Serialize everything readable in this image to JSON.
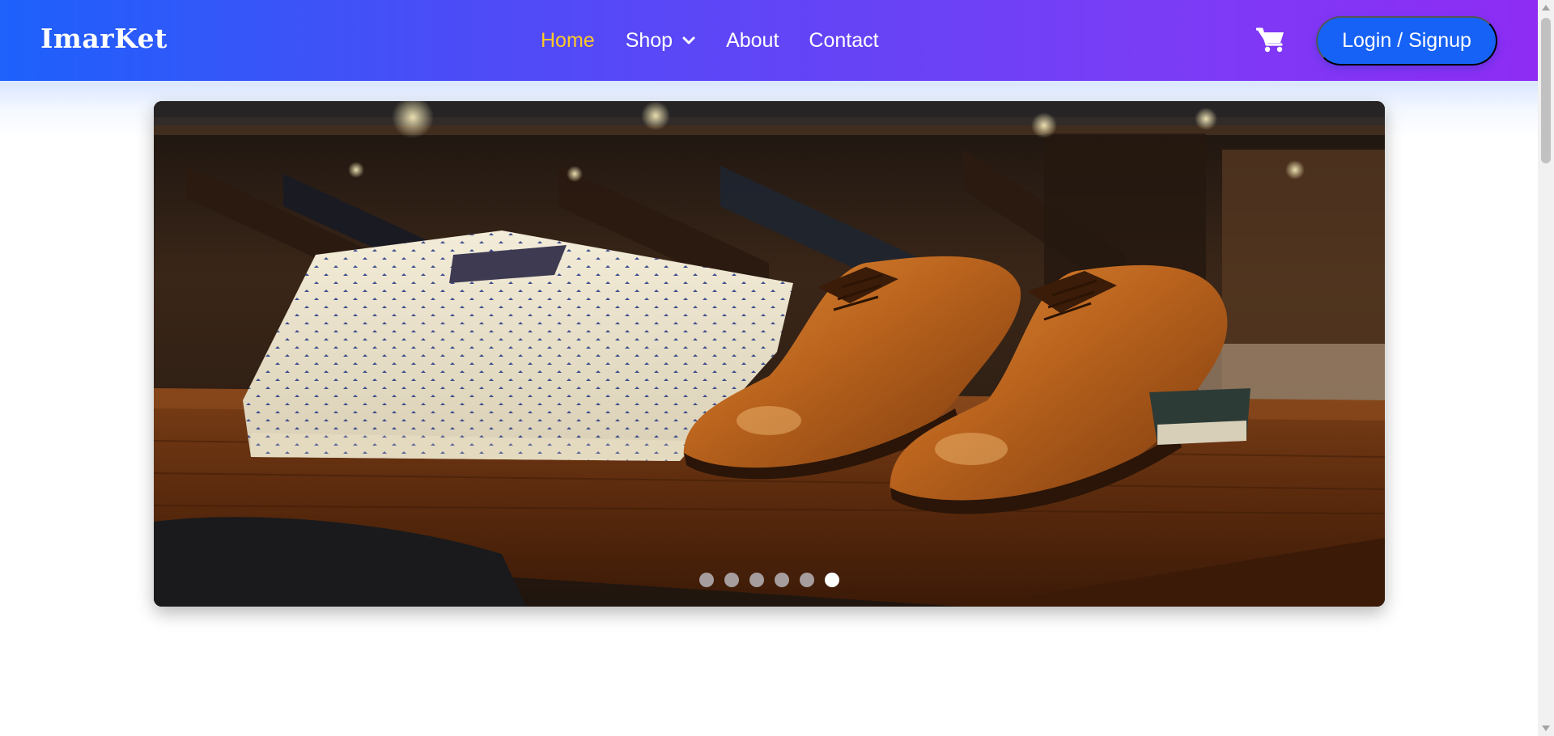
{
  "brand": {
    "name": "ImarKet"
  },
  "nav": {
    "links": [
      {
        "label": "Home",
        "active": true
      },
      {
        "label": "Shop",
        "has_dropdown": true,
        "icon": "chevron-down-icon"
      },
      {
        "label": "About"
      },
      {
        "label": "Contact"
      }
    ]
  },
  "header": {
    "cart_icon": "cart-icon",
    "login_label": "Login / Signup"
  },
  "hero": {
    "slide_count": 6,
    "active_slide": 6
  },
  "colors": {
    "nav_gradient_start": "#1d61fb",
    "nav_gradient_end": "#8e2cf4",
    "active_link": "#ffc928",
    "login_button": "#1662f6",
    "dot_active": "#ffffff",
    "dot_inactive": "#c8c8d2"
  }
}
